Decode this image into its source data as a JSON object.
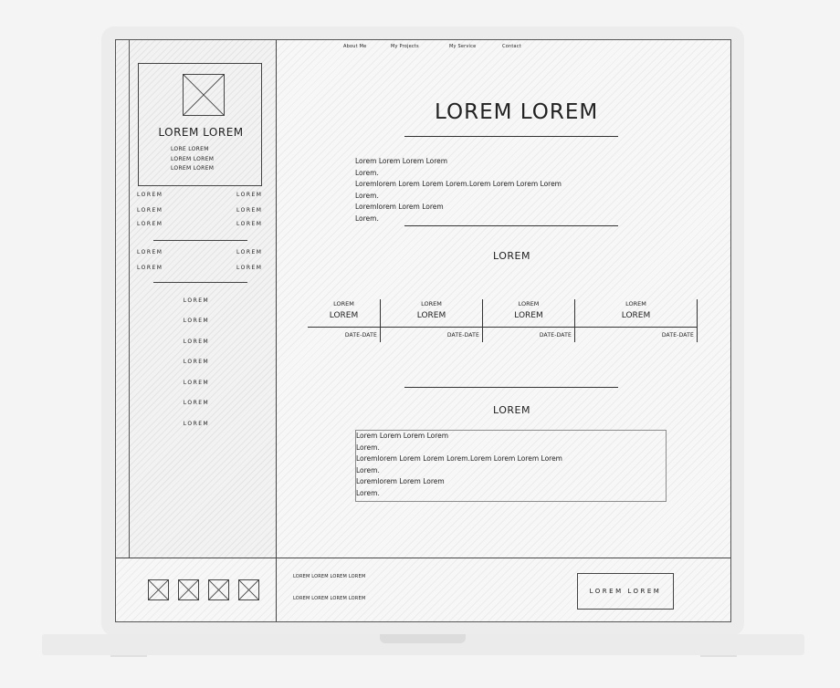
{
  "nav": {
    "items": [
      {
        "label": "About Me"
      },
      {
        "label": "My Projects"
      },
      {
        "label": "My Service"
      },
      {
        "label": "Contact"
      }
    ]
  },
  "sidebar": {
    "profile": {
      "name": "LOREM LOREM",
      "lines": [
        "LORE LOREM",
        "LOREM LOREM",
        "LOREM LOREM"
      ]
    },
    "info_rows_1": [
      {
        "key": "LOREM",
        "value": "LOREM"
      },
      {
        "key": "LOREM",
        "value": "LOREM"
      },
      {
        "key": "LOREM",
        "value": "LOREM"
      }
    ],
    "info_rows_2": [
      {
        "key": "LOREM",
        "value": "LOREM"
      },
      {
        "key": "LOREM",
        "value": "LOREM"
      }
    ],
    "menu": [
      "LOREM",
      "LOREM",
      "LOREM",
      "LOREM",
      "LOREM",
      "LOREM",
      "LOREM"
    ]
  },
  "main": {
    "title": "LOREM LOREM",
    "intro": [
      "Lorem Lorem Lorem Lorem",
      "Lorem.",
      "Loremlorem Lorem Lorem Lorem.Lorem Lorem Lorem Lorem",
      "Lorem.",
      "Loremlorem Lorem Lorem",
      "Lorem."
    ],
    "section1_title": "LOREM",
    "timeline": [
      {
        "top": "LOREM",
        "mid": "LOREM",
        "date": "DATE-DATE"
      },
      {
        "top": "LOREM",
        "mid": "LOREM",
        "date": "DATE-DATE"
      },
      {
        "top": "LOREM",
        "mid": "LOREM",
        "date": "DATE-DATE"
      },
      {
        "top": "LOREM",
        "mid": "LOREM",
        "date": "DATE-DATE"
      }
    ],
    "section2_title": "LOREM",
    "textarea_lines": [
      "Lorem Lorem Lorem Lorem",
      "Lorem.",
      "Loremlorem Lorem Lorem Lorem.Lorem Lorem Lorem Lorem",
      "Lorem.",
      "Loremlorem Lorem Lorem",
      "Lorem."
    ]
  },
  "footer": {
    "text_lines": [
      "LOREM LOREM LOREM LOREM",
      "LOREM LOREM LOREM LOREM"
    ],
    "button_label": "LOREM LOREM",
    "icons": [
      "image-icon",
      "image-icon",
      "image-icon",
      "image-icon"
    ]
  },
  "colors": {
    "sketch_line": "#333333",
    "selection_border": "#4a9de0",
    "device_frame": "#ececec"
  }
}
